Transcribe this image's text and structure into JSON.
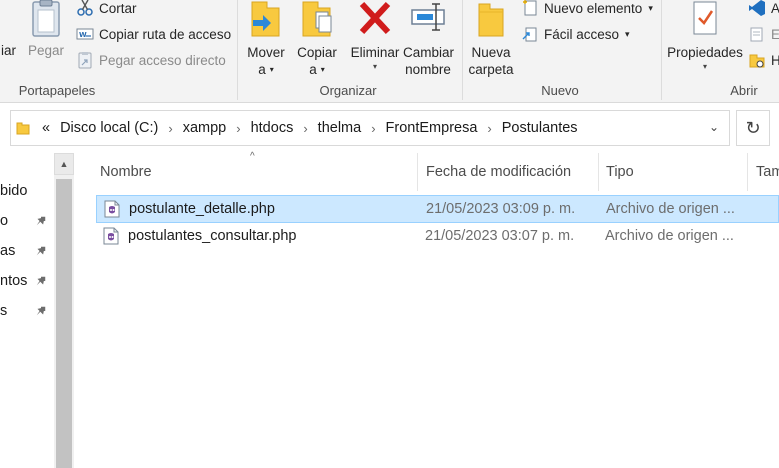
{
  "ribbon": {
    "portapapeles": {
      "pin_label_partial": "iar",
      "paste_label": "Pegar",
      "cut_label": "Cortar",
      "copy_path_label": "Copiar ruta de acceso",
      "paste_shortcut_label": "Pegar acceso directo",
      "group_label": "Portapapeles"
    },
    "organizar": {
      "move_label": "Mover",
      "move_sub": "a",
      "copy_label": "Copiar",
      "copy_sub": "a",
      "delete_label": "Eliminar",
      "rename_label_1": "Cambiar",
      "rename_label_2": "nombre",
      "group_label": "Organizar"
    },
    "nuevo": {
      "new_folder_label_1": "Nueva",
      "new_folder_label_2": "carpeta",
      "new_item_label": "Nuevo elemento",
      "easy_access_label": "Fácil acceso",
      "group_label": "Nuevo"
    },
    "abrir": {
      "properties_label": "Propiedades",
      "open_partial": "A",
      "edit_partial": "E",
      "history_partial": "H",
      "group_label": "Abrir"
    }
  },
  "address": {
    "overflow": "«",
    "crumbs": [
      "Disco local (C:)",
      "xampp",
      "htdocs",
      "thelma",
      "FrontEmpresa",
      "Postulantes"
    ],
    "separator": "›"
  },
  "nav": {
    "items": [
      {
        "label": "bido",
        "pinned": false
      },
      {
        "label": "o",
        "pinned": true
      },
      {
        "label": "as",
        "pinned": true
      },
      {
        "label": "ntos",
        "pinned": true
      },
      {
        "label": "s",
        "pinned": true
      }
    ]
  },
  "columns": {
    "name": "Nombre",
    "date": "Fecha de modificación",
    "type": "Tipo",
    "size": "Tam"
  },
  "files": [
    {
      "name": "postulante_detalle.php",
      "date": "21/05/2023 03:09 p. m.",
      "type": "Archivo de origen ...",
      "selected": true
    },
    {
      "name": "postulantes_consultar.php",
      "date": "21/05/2023 03:07 p. m.",
      "type": "Archivo de origen ...",
      "selected": false
    }
  ],
  "colors": {
    "selection_bg": "#cce8ff",
    "selection_border": "#99d1ff",
    "folder_yellow": "#f8c93f",
    "delete_red": "#d01c1c",
    "arrow_blue": "#2b88d8"
  },
  "icons": {
    "paste": "clipboard-icon",
    "cut": "scissors-icon",
    "copy_path": "copy-path-icon",
    "paste_shortcut": "paste-shortcut-icon",
    "move": "move-to-icon",
    "copy": "copy-to-icon",
    "delete": "delete-x-icon",
    "rename": "rename-icon",
    "new_folder": "new-folder-icon",
    "new_item": "new-item-icon",
    "easy_access": "easy-access-icon",
    "properties": "properties-icon",
    "file": "php-file-icon",
    "pin": "pin-icon"
  }
}
